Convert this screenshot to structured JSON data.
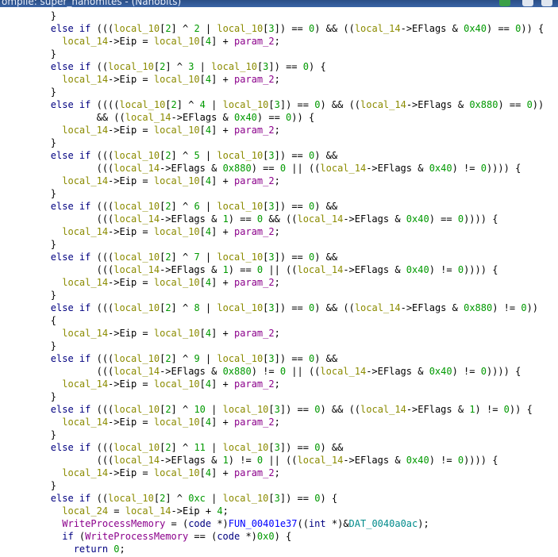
{
  "window": {
    "title": "ompile: super_nanomites - (Nanobits)"
  },
  "colors": {
    "keyword": "#000080",
    "local_var": "#8b8b00",
    "number": "#009900",
    "param": "#8b008b",
    "function": "#0000ff",
    "global": "#008b8b"
  },
  "code_lines": [
    [
      [
        "",
        "        }"
      ]
    ],
    [
      [
        "kw",
        "        else if "
      ],
      [
        "",
        "((("
      ],
      [
        "var",
        "local_10"
      ],
      [
        "",
        "["
      ],
      [
        "num",
        "2"
      ],
      [
        "",
        "] ^ "
      ],
      [
        "num",
        "2"
      ],
      [
        "",
        ""
      ],
      [
        "",
        "",
        " "
      ],
      [
        "",
        "| "
      ],
      [
        "var",
        "local_10"
      ],
      [
        "",
        "["
      ],
      [
        "num",
        "3"
      ],
      [
        "",
        "]) == "
      ],
      [
        "num",
        "0"
      ],
      [
        "",
        ") && (("
      ],
      [
        "var",
        "local_14"
      ],
      [
        "",
        "->EFlags & "
      ],
      [
        "num",
        "0x40"
      ],
      [
        "",
        ") == "
      ],
      [
        "num",
        "0"
      ],
      [
        "",
        "))"
      ],
      [
        "",
        ""
      ],
      [
        "",
        "",
        " {"
      ]
    ],
    [
      [
        "",
        "          "
      ],
      [
        "var",
        "local_14"
      ],
      [
        "",
        "->Eip = "
      ],
      [
        "var",
        "local_10"
      ],
      [
        "",
        "["
      ],
      [
        "num",
        "4"
      ],
      [
        "",
        "] + "
      ],
      [
        "prm",
        "param_2"
      ],
      [
        "",
        ";"
      ]
    ],
    [
      [
        "",
        "        }"
      ]
    ],
    [
      [
        "kw",
        "        else if "
      ],
      [
        "",
        "(("
      ],
      [
        "var",
        "local_10"
      ],
      [
        "",
        "["
      ],
      [
        "num",
        "2"
      ],
      [
        "",
        "] ^ "
      ],
      [
        "num",
        "3"
      ],
      [
        "",
        "",
        " | "
      ],
      [
        "var",
        "local_10"
      ],
      [
        "",
        "["
      ],
      [
        "num",
        "3"
      ],
      [
        "",
        "]) == "
      ],
      [
        "num",
        "0"
      ],
      [
        "",
        ") {"
      ]
    ],
    [
      [
        "",
        "          "
      ],
      [
        "var",
        "local_14"
      ],
      [
        "",
        "->Eip = "
      ],
      [
        "var",
        "local_10"
      ],
      [
        "",
        "["
      ],
      [
        "num",
        "4"
      ],
      [
        "",
        "] + "
      ],
      [
        "prm",
        "param_2"
      ],
      [
        "",
        ";"
      ]
    ],
    [
      [
        "",
        "        }"
      ]
    ],
    [
      [
        "kw",
        "        else if "
      ],
      [
        "",
        "(((("
      ],
      [
        "var",
        "local_10"
      ],
      [
        "",
        "["
      ],
      [
        "num",
        "2"
      ],
      [
        "",
        "] ^ "
      ],
      [
        "num",
        "4"
      ],
      [
        "",
        "",
        " | "
      ],
      [
        "var",
        "local_10"
      ],
      [
        "",
        "["
      ],
      [
        "num",
        "3"
      ],
      [
        "",
        "]) == "
      ],
      [
        "num",
        "0"
      ],
      [
        "",
        ") && (("
      ],
      [
        "var",
        "local_14"
      ],
      [
        "",
        "->EFlags & "
      ],
      [
        "num",
        "0x880"
      ],
      [
        "",
        ") == "
      ],
      [
        "num",
        "0"
      ],
      [
        "",
        "))"
      ]
    ],
    [
      [
        "",
        "                && (("
      ],
      [
        "var",
        "local_14"
      ],
      [
        "",
        "->EFlags & "
      ],
      [
        "num",
        "0x40"
      ],
      [
        "",
        ") == "
      ],
      [
        "num",
        "0"
      ],
      [
        "",
        ")) {"
      ]
    ],
    [
      [
        "",
        "          "
      ],
      [
        "var",
        "local_14"
      ],
      [
        "",
        "->Eip = "
      ],
      [
        "var",
        "local_10"
      ],
      [
        "",
        "["
      ],
      [
        "num",
        "4"
      ],
      [
        "",
        "] + "
      ],
      [
        "prm",
        "param_2"
      ],
      [
        "",
        ";"
      ]
    ],
    [
      [
        "",
        "        }"
      ]
    ],
    [
      [
        "kw",
        "        else if "
      ],
      [
        "",
        "((("
      ],
      [
        "var",
        "local_10"
      ],
      [
        "",
        "["
      ],
      [
        "num",
        "2"
      ],
      [
        "",
        "] ^ "
      ],
      [
        "num",
        "5"
      ],
      [
        "",
        "",
        " | "
      ],
      [
        "var",
        "local_10"
      ],
      [
        "",
        "["
      ],
      [
        "num",
        "3"
      ],
      [
        "",
        "]) == "
      ],
      [
        "num",
        "0"
      ],
      [
        "",
        ") &&"
      ]
    ],
    [
      [
        "",
        "                ((("
      ],
      [
        "var",
        "local_14"
      ],
      [
        "",
        "->EFlags & "
      ],
      [
        "num",
        "0x880"
      ],
      [
        "",
        ") == "
      ],
      [
        "num",
        "0"
      ],
      [
        "",
        "",
        " || (("
      ],
      [
        "var",
        "local_14"
      ],
      [
        "",
        "->EFlags & "
      ],
      [
        "num",
        "0x40"
      ],
      [
        "",
        ") != "
      ],
      [
        "num",
        "0"
      ],
      [
        "",
        "))))"
      ],
      [
        "",
        "",
        " {"
      ]
    ],
    [
      [
        "",
        "          "
      ],
      [
        "var",
        "local_14"
      ],
      [
        "",
        "->Eip = "
      ],
      [
        "var",
        "local_10"
      ],
      [
        "",
        "["
      ],
      [
        "num",
        "4"
      ],
      [
        "",
        "] + "
      ],
      [
        "prm",
        "param_2"
      ],
      [
        "",
        ";"
      ]
    ],
    [
      [
        "",
        "        }"
      ]
    ],
    [
      [
        "kw",
        "        else if "
      ],
      [
        "",
        "((("
      ],
      [
        "var",
        "local_10"
      ],
      [
        "",
        "["
      ],
      [
        "num",
        "2"
      ],
      [
        "",
        "] ^ "
      ],
      [
        "num",
        "6"
      ],
      [
        "",
        "",
        " | "
      ],
      [
        "var",
        "local_10"
      ],
      [
        "",
        "["
      ],
      [
        "num",
        "3"
      ],
      [
        "",
        "]) == "
      ],
      [
        "num",
        "0"
      ],
      [
        "",
        ") &&"
      ]
    ],
    [
      [
        "",
        "                ((("
      ],
      [
        "var",
        "local_14"
      ],
      [
        "",
        "->EFlags & "
      ],
      [
        "num",
        "1"
      ],
      [
        "",
        ") == "
      ],
      [
        "num",
        "0"
      ],
      [
        "",
        "",
        " && (("
      ],
      [
        "var",
        "local_14"
      ],
      [
        "",
        "->EFlags & "
      ],
      [
        "num",
        "0x40"
      ],
      [
        "",
        ") == "
      ],
      [
        "num",
        "0"
      ],
      [
        "",
        "))))"
      ],
      [
        "",
        "",
        " {"
      ]
    ],
    [
      [
        "",
        "          "
      ],
      [
        "var",
        "local_14"
      ],
      [
        "",
        "->Eip = "
      ],
      [
        "var",
        "local_10"
      ],
      [
        "",
        "["
      ],
      [
        "num",
        "4"
      ],
      [
        "",
        "] + "
      ],
      [
        "prm",
        "param_2"
      ],
      [
        "",
        ";"
      ]
    ],
    [
      [
        "",
        "        }"
      ]
    ],
    [
      [
        "kw",
        "        else if "
      ],
      [
        "",
        "((("
      ],
      [
        "var",
        "local_10"
      ],
      [
        "",
        "["
      ],
      [
        "num",
        "2"
      ],
      [
        "",
        "] ^ "
      ],
      [
        "num",
        "7"
      ],
      [
        "",
        "",
        " | "
      ],
      [
        "var",
        "local_10"
      ],
      [
        "",
        "["
      ],
      [
        "num",
        "3"
      ],
      [
        "",
        "]) == "
      ],
      [
        "num",
        "0"
      ],
      [
        "",
        ") &&"
      ]
    ],
    [
      [
        "",
        "                ((("
      ],
      [
        "var",
        "local_14"
      ],
      [
        "",
        "->EFlags & "
      ],
      [
        "num",
        "1"
      ],
      [
        "",
        ") == "
      ],
      [
        "num",
        "0"
      ],
      [
        "",
        "",
        " || (("
      ],
      [
        "var",
        "local_14"
      ],
      [
        "",
        "->EFlags & "
      ],
      [
        "num",
        "0x40"
      ],
      [
        "",
        ") != "
      ],
      [
        "num",
        "0"
      ],
      [
        "",
        "))))"
      ],
      [
        "",
        "",
        " {"
      ]
    ],
    [
      [
        "",
        "          "
      ],
      [
        "var",
        "local_14"
      ],
      [
        "",
        "->Eip = "
      ],
      [
        "var",
        "local_10"
      ],
      [
        "",
        "["
      ],
      [
        "num",
        "4"
      ],
      [
        "",
        "] + "
      ],
      [
        "prm",
        "param_2"
      ],
      [
        "",
        ";"
      ]
    ],
    [
      [
        "",
        "        }"
      ]
    ],
    [
      [
        "kw",
        "        else if "
      ],
      [
        "",
        "((("
      ],
      [
        "var",
        "local_10"
      ],
      [
        "",
        "["
      ],
      [
        "num",
        "2"
      ],
      [
        "",
        "] ^ "
      ],
      [
        "num",
        "8"
      ],
      [
        "",
        "",
        " | "
      ],
      [
        "var",
        "local_10"
      ],
      [
        "",
        "["
      ],
      [
        "num",
        "3"
      ],
      [
        "",
        "]) == "
      ],
      [
        "num",
        "0"
      ],
      [
        "",
        ") && (("
      ],
      [
        "var",
        "local_14"
      ],
      [
        "",
        "->EFlags & "
      ],
      [
        "num",
        "0x880"
      ],
      [
        "",
        ") != "
      ],
      [
        "num",
        "0"
      ],
      [
        "",
        "))"
      ]
    ],
    [
      [
        "",
        "        {"
      ]
    ],
    [
      [
        "",
        "          "
      ],
      [
        "var",
        "local_14"
      ],
      [
        "",
        "->Eip = "
      ],
      [
        "var",
        "local_10"
      ],
      [
        "",
        "["
      ],
      [
        "num",
        "4"
      ],
      [
        "",
        "] + "
      ],
      [
        "prm",
        "param_2"
      ],
      [
        "",
        ";"
      ]
    ],
    [
      [
        "",
        "        }"
      ]
    ],
    [
      [
        "kw",
        "        else if "
      ],
      [
        "",
        "((("
      ],
      [
        "var",
        "local_10"
      ],
      [
        "",
        "["
      ],
      [
        "num",
        "2"
      ],
      [
        "",
        "] ^ "
      ],
      [
        "num",
        "9"
      ],
      [
        "",
        "",
        " | "
      ],
      [
        "var",
        "local_10"
      ],
      [
        "",
        "["
      ],
      [
        "num",
        "3"
      ],
      [
        "",
        "]) == "
      ],
      [
        "num",
        "0"
      ],
      [
        "",
        ") &&"
      ]
    ],
    [
      [
        "",
        "                ((("
      ],
      [
        "var",
        "local_14"
      ],
      [
        "",
        "->EFlags & "
      ],
      [
        "num",
        "0x880"
      ],
      [
        "",
        ") != "
      ],
      [
        "num",
        "0"
      ],
      [
        "",
        "",
        " || (("
      ],
      [
        "var",
        "local_14"
      ],
      [
        "",
        "->EFlags & "
      ],
      [
        "num",
        "0x40"
      ],
      [
        "",
        ") != "
      ],
      [
        "num",
        "0"
      ],
      [
        "",
        "))))"
      ],
      [
        "",
        "",
        " {"
      ]
    ],
    [
      [
        "",
        "          "
      ],
      [
        "var",
        "local_14"
      ],
      [
        "",
        "->Eip = "
      ],
      [
        "var",
        "local_10"
      ],
      [
        "",
        "["
      ],
      [
        "num",
        "4"
      ],
      [
        "",
        "] + "
      ],
      [
        "prm",
        "param_2"
      ],
      [
        "",
        ";"
      ]
    ],
    [
      [
        "",
        "        }"
      ]
    ],
    [
      [
        "kw",
        "        else if "
      ],
      [
        "",
        "((("
      ],
      [
        "var",
        "local_10"
      ],
      [
        "",
        "["
      ],
      [
        "num",
        "2"
      ],
      [
        "",
        "] ^ "
      ],
      [
        "num",
        "10"
      ],
      [
        "",
        "",
        " | "
      ],
      [
        "var",
        "local_10"
      ],
      [
        "",
        "["
      ],
      [
        "num",
        "3"
      ],
      [
        "",
        "]) == "
      ],
      [
        "num",
        "0"
      ],
      [
        "",
        ") && (("
      ],
      [
        "var",
        "local_14"
      ],
      [
        "",
        "->EFlags & "
      ],
      [
        "num",
        "1"
      ],
      [
        "",
        ") != "
      ],
      [
        "num",
        "0"
      ],
      [
        "",
        ")) {"
      ]
    ],
    [
      [
        "",
        "          "
      ],
      [
        "var",
        "local_14"
      ],
      [
        "",
        "->Eip = "
      ],
      [
        "var",
        "local_10"
      ],
      [
        "",
        "["
      ],
      [
        "num",
        "4"
      ],
      [
        "",
        "] + "
      ],
      [
        "prm",
        "param_2"
      ],
      [
        "",
        ";"
      ]
    ],
    [
      [
        "",
        "        }"
      ]
    ],
    [
      [
        "kw",
        "        else if "
      ],
      [
        "",
        "((("
      ],
      [
        "var",
        "local_10"
      ],
      [
        "",
        "["
      ],
      [
        "num",
        "2"
      ],
      [
        "",
        "] ^ "
      ],
      [
        "num",
        "11"
      ],
      [
        "",
        "",
        " | "
      ],
      [
        "var",
        "local_10"
      ],
      [
        "",
        "["
      ],
      [
        "num",
        "3"
      ],
      [
        "",
        "]) == "
      ],
      [
        "num",
        "0"
      ],
      [
        "",
        ") &&"
      ]
    ],
    [
      [
        "",
        "                ((("
      ],
      [
        "var",
        "local_14"
      ],
      [
        "",
        "->EFlags & "
      ],
      [
        "num",
        "1"
      ],
      [
        "",
        ") != "
      ],
      [
        "num",
        "0"
      ],
      [
        "",
        "",
        " || (("
      ],
      [
        "var",
        "local_14"
      ],
      [
        "",
        "->EFlags & "
      ],
      [
        "num",
        "0x40"
      ],
      [
        "",
        ") != "
      ],
      [
        "num",
        "0"
      ],
      [
        "",
        "))))"
      ],
      [
        "",
        "",
        " {"
      ]
    ],
    [
      [
        "",
        "          "
      ],
      [
        "var",
        "local_14"
      ],
      [
        "",
        "->Eip = "
      ],
      [
        "var",
        "local_10"
      ],
      [
        "",
        "["
      ],
      [
        "num",
        "4"
      ],
      [
        "",
        "] + "
      ],
      [
        "prm",
        "param_2"
      ],
      [
        "",
        ";"
      ]
    ],
    [
      [
        "",
        "        }"
      ]
    ],
    [
      [
        "kw",
        "        else if "
      ],
      [
        "",
        "(("
      ],
      [
        "var",
        "local_10"
      ],
      [
        "",
        "["
      ],
      [
        "num",
        "2"
      ],
      [
        "",
        "] ^ "
      ],
      [
        "num",
        "0xc"
      ],
      [
        "",
        "",
        " | "
      ],
      [
        "var",
        "local_10"
      ],
      [
        "",
        "["
      ],
      [
        "num",
        "3"
      ],
      [
        "",
        "]) == "
      ],
      [
        "num",
        "0"
      ],
      [
        "",
        ") {"
      ]
    ],
    [
      [
        "",
        "          "
      ],
      [
        "var",
        "local_24"
      ],
      [
        "",
        "",
        " = "
      ],
      [
        "var",
        "local_14"
      ],
      [
        "",
        "->Eip + "
      ],
      [
        "num",
        "4"
      ],
      [
        "",
        ";"
      ]
    ],
    [
      [
        "",
        "          "
      ],
      [
        "prm",
        "WriteProcessMemory"
      ],
      [
        "",
        "",
        " = ("
      ],
      [
        "typ",
        "code"
      ],
      [
        "",
        "",
        " *)"
      ],
      [
        "fn",
        "FUN_00401e37"
      ],
      [
        "",
        "(("
      ],
      [
        "typ",
        "int"
      ],
      [
        "",
        "",
        " *)&"
      ],
      [
        "glb",
        "DAT_0040a0ac"
      ],
      [
        "",
        ");"
      ]
    ],
    [
      [
        "kw",
        "          if "
      ],
      [
        "",
        "("
      ],
      [
        "prm",
        "WriteProcessMemory"
      ],
      [
        "",
        "",
        " == ("
      ],
      [
        "typ",
        "code"
      ],
      [
        "",
        "",
        " *)"
      ],
      [
        "num",
        "0x0"
      ],
      [
        "",
        ") {"
      ]
    ],
    [
      [
        "kw",
        "            return "
      ],
      [
        "num",
        "0"
      ],
      [
        "",
        ";"
      ]
    ]
  ]
}
